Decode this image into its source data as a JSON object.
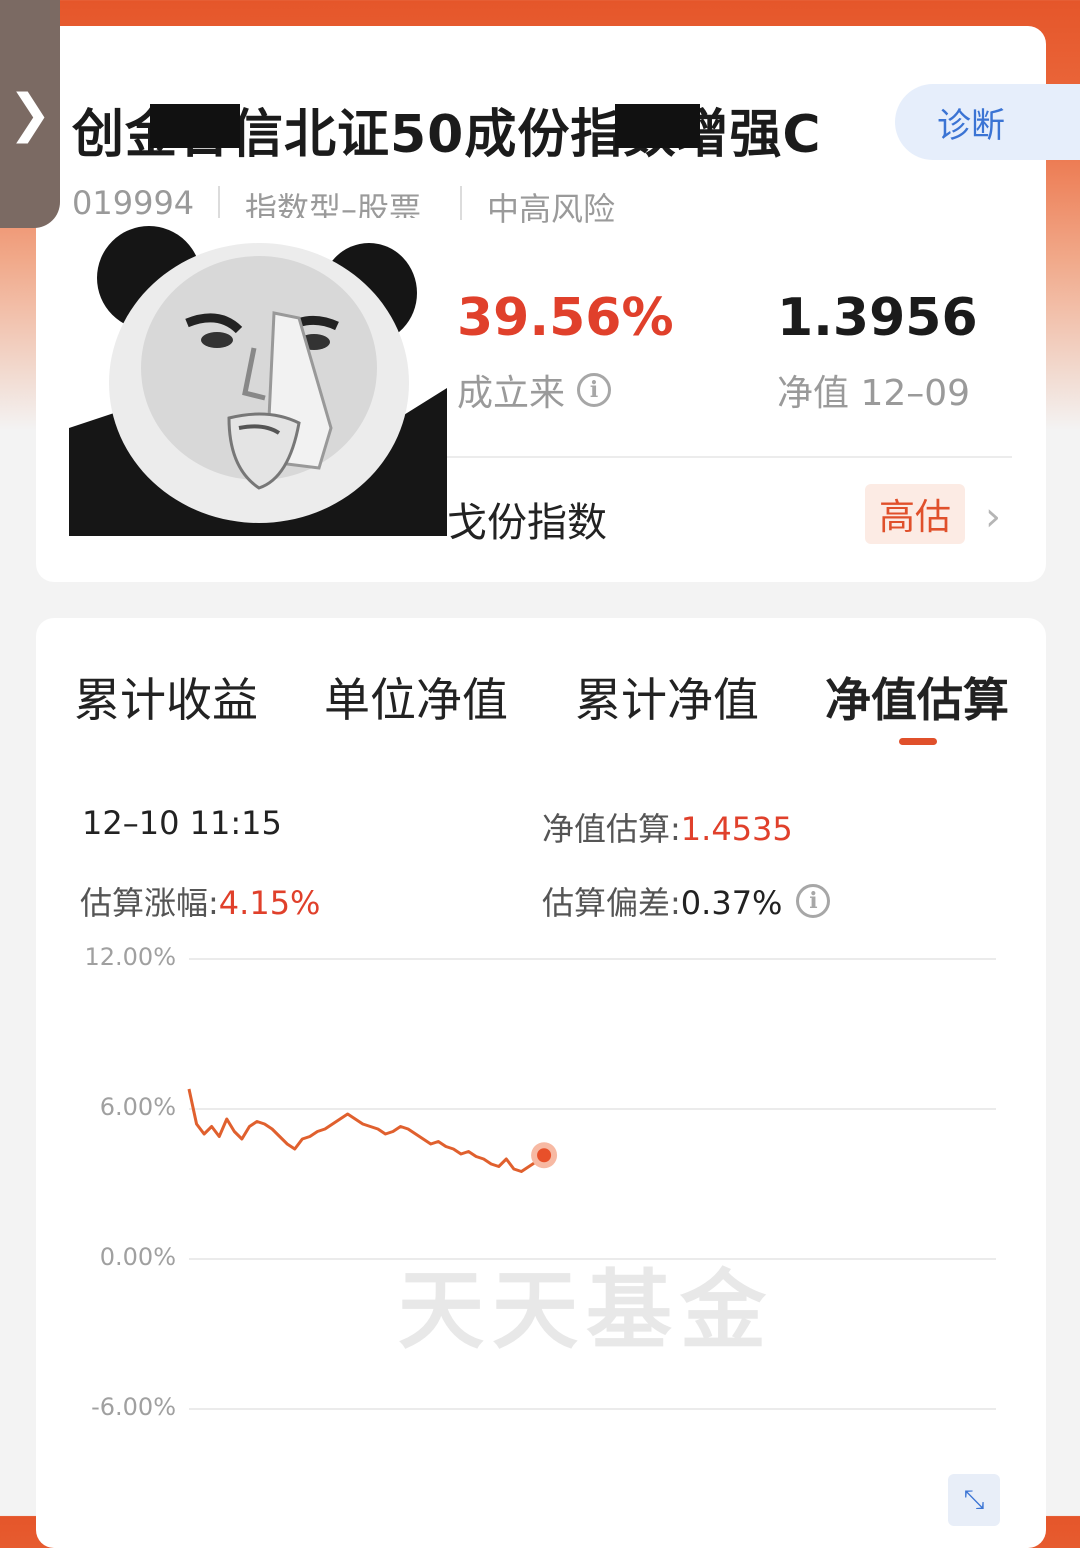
{
  "header": {
    "back_glyph": "❯",
    "fund_title": "创金合信北证50成份指数增强C",
    "diagnose_label": "诊断",
    "fund_code": "019994",
    "fund_type": "指数型–股票",
    "risk_level": "中高风险"
  },
  "summary": {
    "return_since_inception": "39.56%",
    "return_label": "成立来",
    "nav_value": "1.3956",
    "nav_label": "净值 12–09",
    "index_name": "戈份指数",
    "valuation_badge": "高估",
    "chevron": "›"
  },
  "tabs": [
    {
      "label": "累计收益",
      "active": false
    },
    {
      "label": "单位净值",
      "active": false
    },
    {
      "label": "累计净值",
      "active": false
    },
    {
      "label": "净值估算",
      "active": true
    }
  ],
  "estimate": {
    "time": "12–10 11:15",
    "nav_est_label": "净值估算:",
    "nav_est_value": "1.4535",
    "change_label": "估算涨幅:",
    "change_value": "4.15%",
    "deviation_label": "估算偏差:",
    "deviation_value": "0.37%"
  },
  "watermark_text": "天天基金",
  "expand_icon": "⤡",
  "colors": {
    "accent": "#e0502b",
    "header_orange": "#e5562a",
    "line": "#e0602e",
    "diag_blue": "#3b74d4"
  },
  "chart_data": {
    "type": "line",
    "title": "",
    "ylabel": "",
    "ylim": [
      -6,
      12
    ],
    "yticks": [
      "12.00%",
      "6.00%",
      "0.00%",
      "-6.00%"
    ],
    "grid": true,
    "series": [
      {
        "values": [
          6.8,
          5.4,
          5.0,
          5.3,
          4.9,
          5.6,
          5.1,
          4.8,
          5.3,
          5.5,
          5.4,
          5.2,
          4.9,
          4.6,
          4.4,
          4.8,
          4.9,
          5.1,
          5.2,
          5.4,
          5.6,
          5.8,
          5.6,
          5.4,
          5.3,
          5.2,
          5.0,
          5.1,
          5.3,
          5.2,
          5.0,
          4.8,
          4.6,
          4.7,
          4.5,
          4.4,
          4.2,
          4.3,
          4.1,
          4.0,
          3.8,
          3.7,
          4.0,
          3.6,
          3.5,
          3.7,
          3.9,
          4.15
        ],
        "last_value": 4.15
      }
    ],
    "x_session_fraction_end": 0.44
  }
}
